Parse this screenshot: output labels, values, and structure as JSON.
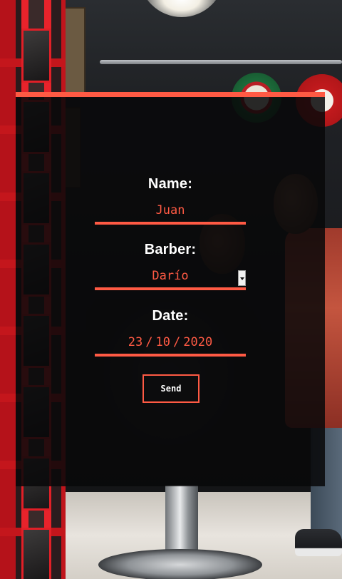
{
  "form": {
    "name_label": "Name:",
    "name_value": "Juan",
    "barber_label": "Barber:",
    "barber_value": "Darío",
    "date_label": "Date:",
    "date_day": "23",
    "date_month": "10",
    "date_year": "2020",
    "date_separator": "/",
    "send_label": "Send"
  },
  "colors": {
    "accent": "#ff5a44",
    "card_background": "rgba(8,8,9,0.86)",
    "label_text": "#ffffff"
  },
  "icons": {
    "select_arrow": "chevron-down-icon"
  }
}
